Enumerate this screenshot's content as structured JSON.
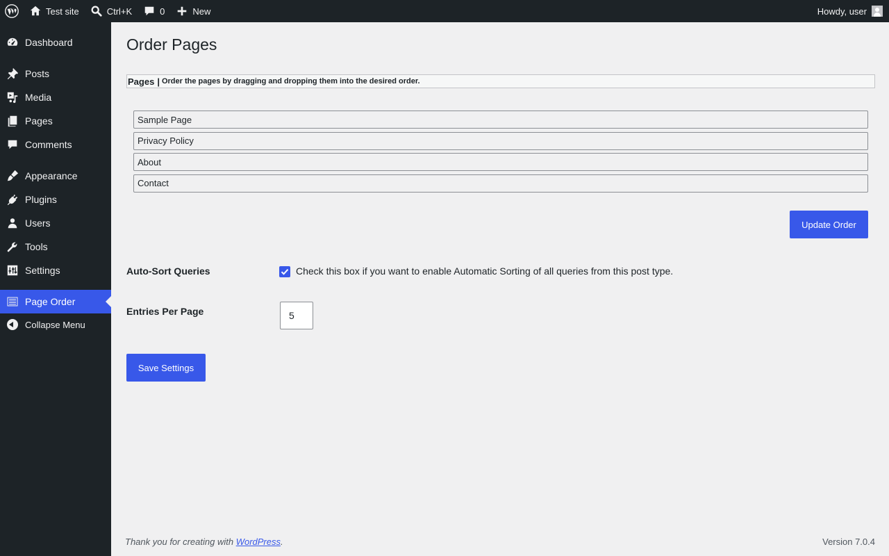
{
  "adminbar": {
    "site_name": "Test site",
    "search_shortcut": "Ctrl+K",
    "comments_count": "0",
    "new_label": "New",
    "greeting": "Howdy, user",
    "icons": [
      "wordpress-logo",
      "home-icon",
      "search-icon",
      "comment-icon",
      "plus-icon",
      "avatar"
    ]
  },
  "sidebar": {
    "items": [
      {
        "label": "Dashboard",
        "icon": "dashboard-icon"
      },
      {
        "label": "Posts",
        "icon": "pin-icon"
      },
      {
        "label": "Media",
        "icon": "media-icon"
      },
      {
        "label": "Pages",
        "icon": "pages-icon"
      },
      {
        "label": "Comments",
        "icon": "comment-icon"
      },
      {
        "label": "Appearance",
        "icon": "brush-icon"
      },
      {
        "label": "Plugins",
        "icon": "plug-icon"
      },
      {
        "label": "Users",
        "icon": "user-icon"
      },
      {
        "label": "Tools",
        "icon": "wrench-icon"
      },
      {
        "label": "Settings",
        "icon": "sliders-icon"
      },
      {
        "label": "Page Order",
        "icon": "list-icon",
        "current": true
      },
      {
        "label": "Collapse Menu",
        "icon": "collapse-icon"
      }
    ]
  },
  "main": {
    "title": "Order Pages",
    "list_header": {
      "strong": "Pages",
      "separator": "|",
      "description": "Order the pages by dragging and dropping them into the desired order."
    },
    "pages": [
      "Sample Page",
      "Privacy Policy",
      "About",
      "Contact"
    ],
    "update_button": "Update Order",
    "autosort": {
      "label": "Auto-Sort Queries",
      "checked": true,
      "description": "Check this box if you want to enable Automatic Sorting of all queries from this post type."
    },
    "entries": {
      "label": "Entries Per Page",
      "value": "5"
    },
    "save_button": "Save Settings"
  },
  "footer": {
    "text_before": "Thank you for creating with ",
    "link_text": "WordPress",
    "text_after": ".",
    "version": "Version 7.0.4"
  },
  "colors": {
    "accent": "#3858e9",
    "adminbar_bg": "#1d2327",
    "content_bg": "#f0f0f1"
  }
}
